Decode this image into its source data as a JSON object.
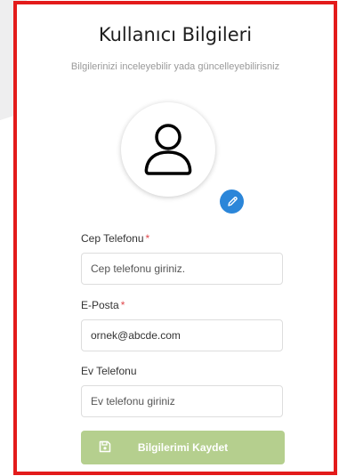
{
  "header": {
    "title": "Kullanıcı Bilgileri",
    "subtitle": "Bilgilerinizi inceleyebilir yada güncelleyebilirisniz"
  },
  "avatar": {
    "icon": "user-icon",
    "edit_icon": "pencil-icon"
  },
  "form": {
    "mobile": {
      "label": "Cep Telefonu",
      "required_mark": "*",
      "placeholder": "Cep telefonu giriniz.",
      "value": ""
    },
    "email": {
      "label": "E-Posta",
      "required_mark": "*",
      "placeholder": "",
      "value": "ornek@abcde.com"
    },
    "home_phone": {
      "label": "Ev Telefonu",
      "placeholder": "Ev telefonu giriniz",
      "value": ""
    }
  },
  "save_button": {
    "label": "Bilgilerimi Kaydet",
    "icon": "floppy-disk-icon"
  },
  "colors": {
    "border_highlight": "#e31b1b",
    "edit_badge": "#2b86d9",
    "save_button_bg": "#b5cf8e",
    "required": "#e0484c"
  }
}
